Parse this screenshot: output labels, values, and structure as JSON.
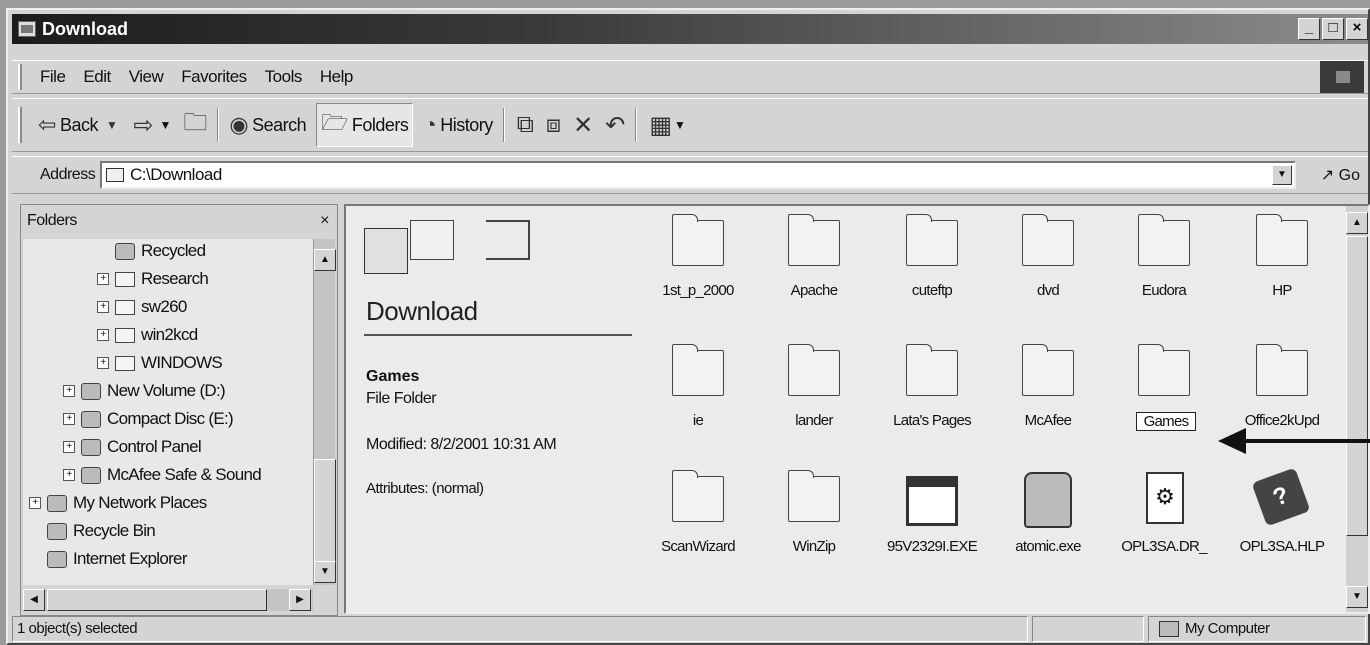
{
  "window": {
    "title": "Download",
    "controls": [
      "_",
      "□",
      "×"
    ]
  },
  "menu": [
    "File",
    "Edit",
    "View",
    "Favorites",
    "Tools",
    "Help"
  ],
  "toolbar": {
    "back": "Back",
    "search": "Search",
    "folders": "Folders",
    "history": "History"
  },
  "address": {
    "label": "Address",
    "value": "C:\\Download",
    "go": "Go"
  },
  "folders_pane": {
    "title": "Folders",
    "close": "×",
    "items": [
      {
        "label": "Recycled"
      },
      {
        "label": "Research",
        "expand": "+"
      },
      {
        "label": "sw260",
        "expand": "+"
      },
      {
        "label": "win2kcd",
        "expand": "+"
      },
      {
        "label": "WINDOWS",
        "expand": "+"
      },
      {
        "label": "New Volume (D:)",
        "expand": "+"
      },
      {
        "label": "Compact Disc (E:)",
        "expand": "+"
      },
      {
        "label": "Control Panel",
        "expand": "+"
      },
      {
        "label": "McAfee Safe & Sound",
        "expand": "+"
      },
      {
        "label": "My Network Places",
        "expand": "+"
      },
      {
        "label": "Recycle Bin"
      },
      {
        "label": "Internet Explorer"
      }
    ]
  },
  "panel": {
    "title": "Download",
    "selected_name": "Games",
    "selected_type": "File Folder",
    "modified": "Modified: 8/2/2001 10:31 AM",
    "attributes": "Attributes: (normal)"
  },
  "files": [
    {
      "name": "1st_p_2000",
      "kind": "folder"
    },
    {
      "name": "Apache",
      "kind": "folder"
    },
    {
      "name": "cuteftp",
      "kind": "folder"
    },
    {
      "name": "dvd",
      "kind": "folder"
    },
    {
      "name": "Eudora",
      "kind": "folder"
    },
    {
      "name": "HP",
      "kind": "folder"
    },
    {
      "name": "ie",
      "kind": "folder"
    },
    {
      "name": "lander",
      "kind": "folder"
    },
    {
      "name": "Lata's Pages",
      "kind": "folder-web"
    },
    {
      "name": "McAfee",
      "kind": "folder"
    },
    {
      "name": "Games",
      "kind": "folder",
      "selected": true
    },
    {
      "name": "Office2kUpd",
      "kind": "folder"
    },
    {
      "name": "ScanWizard",
      "kind": "folder"
    },
    {
      "name": "WinZip",
      "kind": "folder"
    },
    {
      "name": "95V2329I.EXE",
      "kind": "exe"
    },
    {
      "name": "atomic.exe",
      "kind": "app"
    },
    {
      "name": "OPL3SA.DR_",
      "kind": "driver"
    },
    {
      "name": "OPL3SA.HLP",
      "kind": "help"
    }
  ],
  "status": {
    "left": "1 object(s) selected",
    "right": "My Computer"
  }
}
